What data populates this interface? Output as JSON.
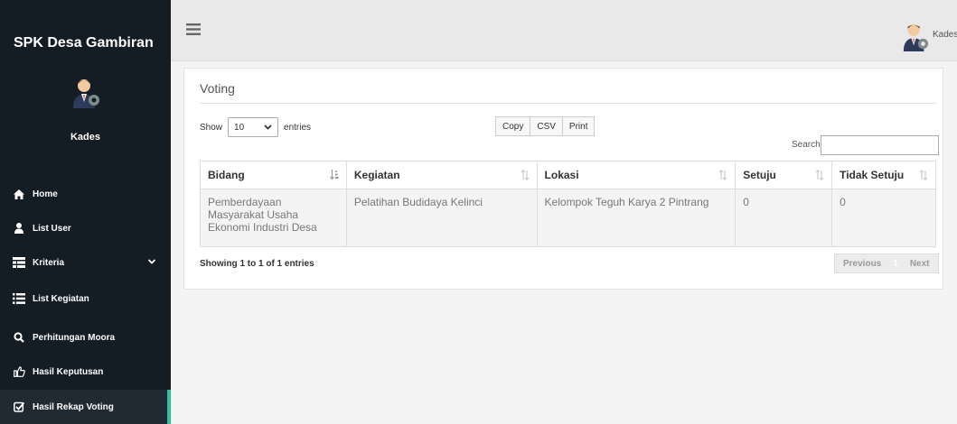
{
  "sidebar": {
    "brand": "SPK Desa Gambiran",
    "profile_name": "Kades",
    "items": [
      {
        "label": "Home",
        "icon": "home-icon"
      },
      {
        "label": "List User",
        "icon": "user-icon"
      },
      {
        "label": "Kriteria",
        "icon": "table-icon"
      },
      {
        "label": "List Kegiatan",
        "icon": "list-icon"
      },
      {
        "label": "Perhitungan Moora",
        "icon": "search-icon"
      },
      {
        "label": "Hasil Keputusan",
        "icon": "thumbs-up-icon"
      },
      {
        "label": "Hasil Rekap Voting",
        "icon": "checkbox-icon"
      }
    ],
    "active_index": 6,
    "accent_color": "#2fbfa0",
    "bg_color": "#151d24"
  },
  "topbar": {
    "user_name": "Kades"
  },
  "card": {
    "title": "Voting",
    "show_label": "Show",
    "entries_label": "entries",
    "page_length": "10",
    "buttons": {
      "copy": "Copy",
      "csv": "CSV",
      "print": "Print"
    },
    "search_label": "Search:",
    "search_value": ""
  },
  "table": {
    "columns": [
      "Bidang",
      "Kegiatan",
      "Lokasi",
      "Setuju",
      "Tidak Setuju"
    ],
    "rows": [
      {
        "bidang": "Pemberdayaan Masyarakat Usaha Ekonomi Industri Desa",
        "kegiatan": "Pelatihan Budidaya Kelinci",
        "lokasi": "Kelompok Teguh Karya 2 Pintrang",
        "setuju": "0",
        "tidak_setuju": "0"
      }
    ]
  },
  "footer": {
    "info": "Showing 1 to 1 of 1 entries",
    "previous": "Previous",
    "current_page": "1",
    "next": "Next"
  }
}
